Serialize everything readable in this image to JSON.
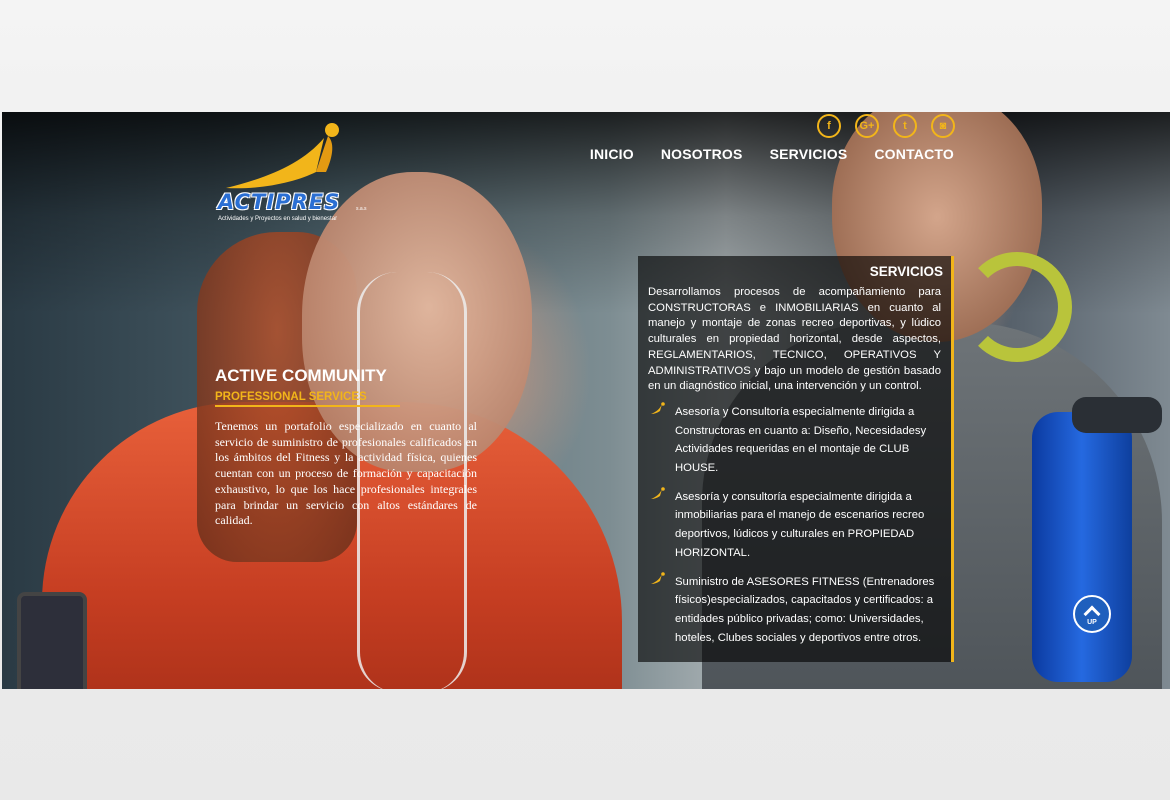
{
  "logo": {
    "name": "ACTIPRES",
    "suffix": "s.a.s",
    "tagline": "Actividades y Proyectos en salud y bienestar"
  },
  "social": [
    {
      "icon": "facebook-icon",
      "glyph": "f"
    },
    {
      "icon": "google-plus-icon",
      "glyph": "G+"
    },
    {
      "icon": "twitter-icon",
      "glyph": "t"
    },
    {
      "icon": "instagram-icon",
      "glyph": "◙"
    }
  ],
  "nav": {
    "items": [
      "INICIO",
      "NOSOTROS",
      "SERVICIOS",
      "CONTACTO"
    ]
  },
  "intro": {
    "title": "ACTIVE COMMUNITY",
    "subtitle": "PROFESSIONAL SERVICES",
    "body": "Tenemos un portafolio especializado en cuanto al servicio de suministro de profesionales calificados en los ámbitos del Fitness y la actividad física, quienes cuentan con un proceso de formación y capacitación exhaustivo, lo que los hace profesionales integrales para brindar un servicio con altos estándares de calidad."
  },
  "services": {
    "title": "SERVICIOS",
    "intro": "Desarrollamos procesos de acompañamiento para CONSTRUCTORAS e INMOBILIARIAS en cuanto al manejo y montaje de zonas recreo deportivas, y lúdico culturales en propiedad horizontal, desde aspectos, REGLAMENTARIOS, TECNICO, OPERATIVOS Y ADMINISTRATIVOS y bajo un modelo de gestión basado en un diagnóstico inicial, una intervención y un control.",
    "items": [
      "Asesoría y Consultoría especialmente dirigida a Constructoras en cuanto a: Diseño, Necesidadesy Actividades requeridas en el montaje de CLUB HOUSE.",
      "Asesoría y consultoría especialmente dirigida a inmobiliarias para el manejo de escenarios recreo deportivos, lúdicos y culturales en PROPIEDAD HORIZONTAL.",
      "Suministro de ASESORES FITNESS (Entrenadores físicos)especializados, capacitados y certificados: a entidades público privadas; como: Universidades, hoteles, Clubes sociales y deportivos entre otros."
    ]
  },
  "up_button": {
    "label": "UP"
  },
  "colors": {
    "accent": "#f2b51a",
    "logo_blue": "#2b6fd3",
    "up_button": "#1e5fbd"
  }
}
